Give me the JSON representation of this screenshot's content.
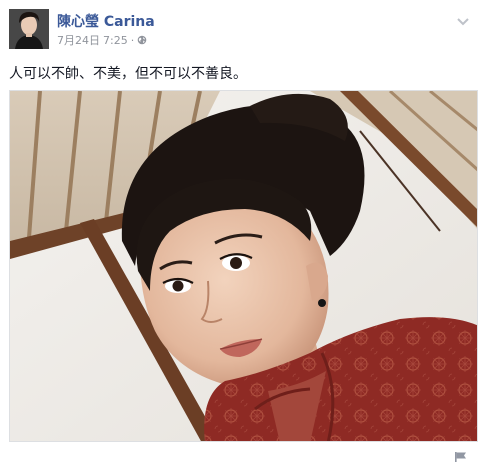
{
  "post": {
    "author_name": "陳心瑩 Carina",
    "date": "7月24日",
    "time": "7:25",
    "separator": "·",
    "privacy_icon": "globe-icon",
    "options_icon": "chevron-down-icon",
    "status_text": "人可以不帥、不美，但不可以不善良。",
    "photo_icon": "photo",
    "footer_icon": "flag-icon"
  },
  "colors": {
    "author_link": "#3b5998",
    "meta_text": "#90949c",
    "body_text": "#141823",
    "photo_border": "#dddfe2",
    "garment_red": "#8e2a24"
  }
}
